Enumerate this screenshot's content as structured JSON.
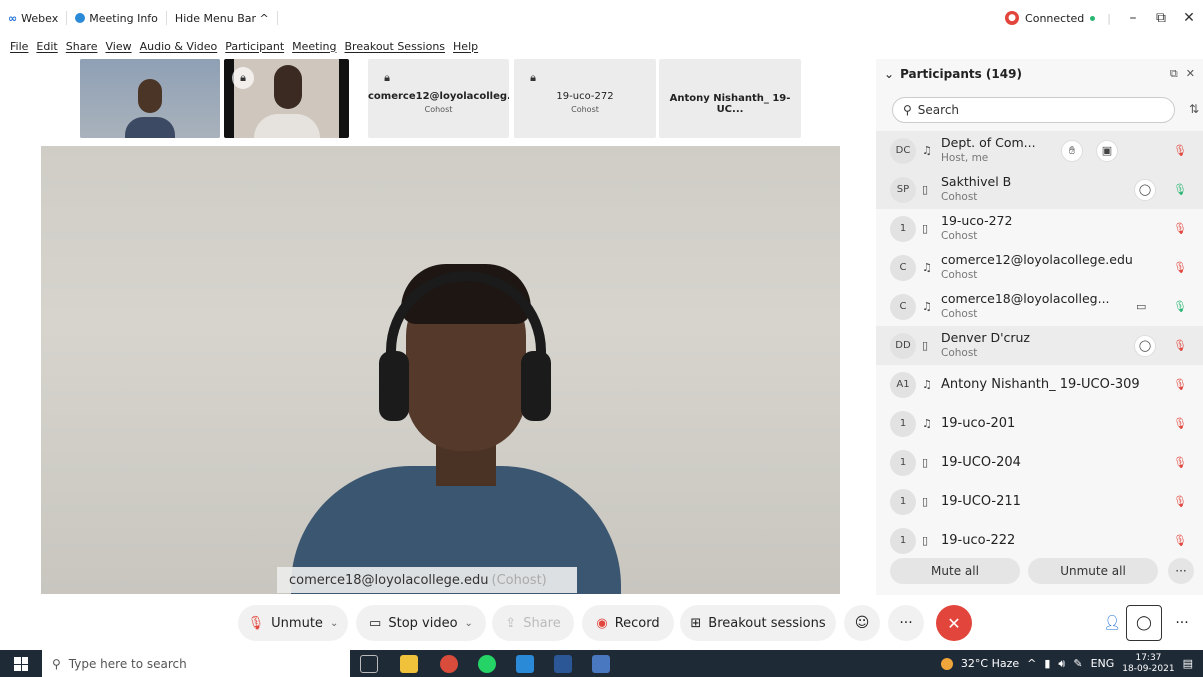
{
  "titlebar": {
    "app_name": "Webex",
    "meeting_info": "Meeting Info",
    "hide_menu": "Hide Menu Bar ^",
    "status": "Connected",
    "minimize": "–",
    "restore": "⧉",
    "close": "✕"
  },
  "menu": [
    "File",
    "Edit",
    "Share",
    "View",
    "Audio & Video",
    "Participant",
    "Meeting",
    "Breakout Sessions",
    "Help"
  ],
  "filmstrip": [
    {
      "name": "",
      "role": ""
    },
    {
      "name": "",
      "role": ""
    },
    {
      "name": "comerce12@loyolacolleg...",
      "role": "Cohost"
    },
    {
      "name": "19-uco-272",
      "role": "Cohost"
    },
    {
      "name": "Antony Nishanth_ 19-UC...",
      "role": ""
    }
  ],
  "main_video": {
    "speaker": "comerce18@loyolacollege.edu",
    "speaker_role": "(Cohost)"
  },
  "controls": {
    "unmute": "Unmute",
    "stop_video": "Stop video",
    "share": "Share",
    "record": "Record",
    "breakout": "Breakout sessions",
    "more": "···"
  },
  "panel": {
    "title": "Participants (149)",
    "search_placeholder": "Search",
    "mute_all": "Mute all",
    "unmute_all": "Unmute all",
    "more": "···"
  },
  "participants": [
    {
      "initials": "DC",
      "name": "Dept. of Com...",
      "role": "Host, me"
    },
    {
      "initials": "SP",
      "name": "Sakthivel B",
      "role": "Cohost"
    },
    {
      "initials": "1",
      "name": "19-uco-272",
      "role": "Cohost"
    },
    {
      "initials": "C",
      "name": "comerce12@loyolacollege.edu",
      "role": "Cohost"
    },
    {
      "initials": "C",
      "name": "comerce18@loyolacolleg...",
      "role": "Cohost"
    },
    {
      "initials": "DD",
      "name": "Denver D'cruz",
      "role": "Cohost"
    },
    {
      "initials": "A1",
      "name": "Antony Nishanth_ 19-UCO-309",
      "role": ""
    },
    {
      "initials": "1",
      "name": "19-uco-201",
      "role": ""
    },
    {
      "initials": "1",
      "name": "19-UCO-204",
      "role": ""
    },
    {
      "initials": "1",
      "name": "19-UCO-211",
      "role": ""
    },
    {
      "initials": "1",
      "name": "19-uco-222",
      "role": ""
    }
  ],
  "taskbar": {
    "search_placeholder": "Type here to search",
    "weather": "32°C Haze",
    "lang": "ENG",
    "time": "17:37",
    "date": "18-09-2021"
  }
}
